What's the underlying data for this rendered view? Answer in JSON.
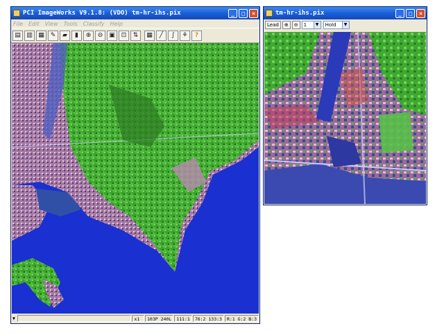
{
  "main_window": {
    "title": "PCI ImageWorks V9.1.8: (VDO) tm-hr-ihs.pix",
    "controls": {
      "minimize": "_",
      "maximize": "□",
      "close": "×"
    },
    "menu": [
      "File",
      "Edit",
      "View",
      "Tools",
      "Classify",
      "Help"
    ],
    "toolbar_icons": [
      "open-folder-icon",
      "open-file-icon",
      "save-icon",
      "pencil-icon",
      "brush-icon",
      "histogram-icon",
      "zoom-in-icon",
      "zoom-out-icon",
      "zoom-fit-icon",
      "zoom-region-icon",
      "rgb-icon",
      "calculator-icon",
      "line-icon",
      "curve-icon",
      "transform-icon",
      "help-icon"
    ],
    "toolbar_glyphs": [
      "▤",
      "▥",
      "▦",
      "✎",
      "▰",
      "▮",
      "⊕",
      "⊖",
      "▣",
      "⊡",
      "⇅",
      "▦",
      "╱",
      "∫",
      "⚘",
      "?"
    ],
    "status": {
      "arrow": "▼",
      "zoom": "x1",
      "position": "103P 240L",
      "channels": "111:1",
      "values": "76:2 133:3",
      "rgb": "R:1 G:2 B:3"
    },
    "map_colors": {
      "sea": "#1c2fd0",
      "land": "#48b83a",
      "urban": "#b07a9a"
    }
  },
  "view_window": {
    "title": "tm-hr-ihs.pix",
    "controls": {
      "minimize": "_",
      "maximize": "□",
      "close": "×"
    },
    "lead_label": "Lead",
    "zoom_in": "⊕",
    "zoom_out": "⊖",
    "zoom_value": "1",
    "mode_value": "Hold"
  }
}
